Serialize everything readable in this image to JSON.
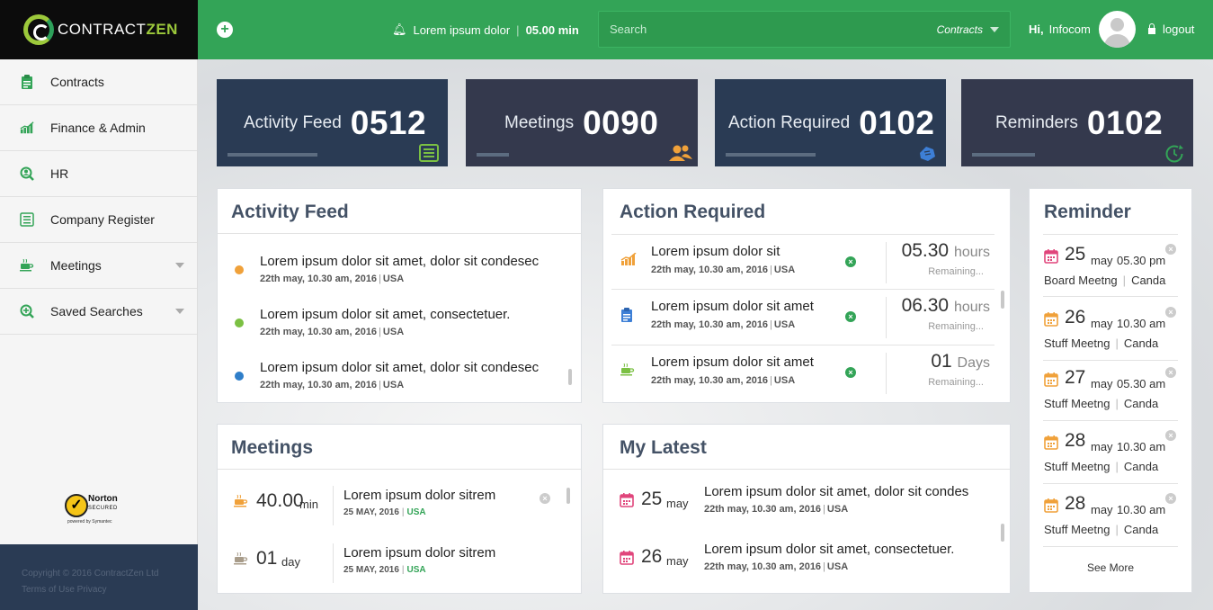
{
  "brand": {
    "name_part1": "CONTRACT",
    "name_part2": "ZEN"
  },
  "topbar": {
    "notification_text": "Lorem ipsum dolor",
    "notification_time": "05.00 min",
    "search_placeholder": "Search",
    "search_scope": "Contracts",
    "greeting": "Hi,",
    "user_name": "Infocom",
    "logout_label": "logout"
  },
  "sidebar": {
    "items": [
      {
        "label": "Contracts",
        "icon": "clipboard-icon"
      },
      {
        "label": "Finance & Admin",
        "icon": "bar-chart-icon"
      },
      {
        "label": "HR",
        "icon": "user-search-icon"
      },
      {
        "label": "Company Register",
        "icon": "list-icon"
      },
      {
        "label": "Meetings",
        "icon": "coffee-cup-icon"
      },
      {
        "label": "Saved Searches",
        "icon": "search-plus-icon"
      }
    ],
    "norton": {
      "brand": "Norton",
      "tag": "SECURED",
      "powered": "powered by Symantec"
    },
    "footer": {
      "copyright": "Copyright © 2016 ContractZen Ltd",
      "links": "Terms of Use Privacy"
    }
  },
  "tiles": [
    {
      "label": "Activity Feed",
      "value": "0512",
      "color": "#2a3b54",
      "icon": "list-icon",
      "icon_color": "#7bc043"
    },
    {
      "label": "Meetings",
      "value": "0090",
      "color": "#34394d",
      "icon": "users-icon",
      "icon_color": "#f0a13a"
    },
    {
      "label": "Action Required",
      "value": "0102",
      "color": "#2a3b54",
      "icon": "hand-icon",
      "icon_color": "#3d7fd6"
    },
    {
      "label": "Reminders",
      "value": "0102",
      "color": "#34394d",
      "icon": "refresh-clock-icon",
      "icon_color": "#33a457"
    }
  ],
  "activity_feed": {
    "title": "Activity Feed",
    "items": [
      {
        "text": "Lorem ipsum dolor sit amet, dolor sit condesec",
        "date": "22th may, 10.30 am, 2016",
        "loc": "USA",
        "dot": "#f0a13a"
      },
      {
        "text": "Lorem ipsum dolor sit amet, consectetuer.",
        "date": "22th may, 10.30 am, 2016",
        "loc": "USA",
        "dot": "#7bc043"
      },
      {
        "text": "Lorem ipsum dolor sit amet, dolor sit condesec",
        "date": "22th may, 10.30 am, 2016",
        "loc": "USA",
        "dot": "#2f7ec9"
      }
    ]
  },
  "action_required": {
    "title": "Action Required",
    "items": [
      {
        "text": "Lorem ipsum dolor sit",
        "date": "22th may, 10.30 am, 2016",
        "loc": "USA",
        "value": "05.30",
        "unit": "hours",
        "remaining": "Remaining...",
        "icon": "bar-chart-icon"
      },
      {
        "text": "Lorem ipsum dolor sit amet",
        "date": "22th may, 10.30 am, 2016",
        "loc": "USA",
        "value": "06.30",
        "unit": "hours",
        "remaining": "Remaining...",
        "icon": "clipboard-icon"
      },
      {
        "text": "Lorem ipsum dolor sit amet",
        "date": "22th may, 10.30 am, 2016",
        "loc": "USA",
        "value": "01",
        "unit": "Days",
        "remaining": "Remaining...",
        "icon": "coffee-cup-icon"
      }
    ]
  },
  "reminder": {
    "title": "Reminder",
    "see_more": "See More",
    "items": [
      {
        "day": "25",
        "month": "may",
        "time": "05.30 pm",
        "event": "Board Meetng",
        "place": "Canda",
        "cal_color": "#e0457b"
      },
      {
        "day": "26",
        "month": "may",
        "time": "10.30 am",
        "event": "Stuff Meetng",
        "place": "Canda",
        "cal_color": "#f0a13a"
      },
      {
        "day": "27",
        "month": "may",
        "time": "05.30 am",
        "event": "Stuff Meetng",
        "place": "Canda",
        "cal_color": "#f0a13a"
      },
      {
        "day": "28",
        "month": "may",
        "time": "10.30 am",
        "event": "Stuff Meetng",
        "place": "Canda",
        "cal_color": "#f0a13a"
      },
      {
        "day": "28",
        "month": "may",
        "time": "10.30 am",
        "event": "Stuff Meetng",
        "place": "Canda",
        "cal_color": "#f0a13a"
      }
    ]
  },
  "meetings": {
    "title": "Meetings",
    "items": [
      {
        "num": "40.00",
        "unit": "min",
        "text": "Lorem ipsum dolor sitrem",
        "date": "25 MAY, 2016",
        "loc": "USA"
      },
      {
        "num": "01",
        "unit": "day",
        "text": "Lorem ipsum dolor sitrem",
        "date": "25 MAY, 2016",
        "loc": "USA"
      }
    ]
  },
  "my_latest": {
    "title": "My Latest",
    "items": [
      {
        "day": "25",
        "month": "may",
        "text": "Lorem ipsum dolor sit amet, dolor sit condes",
        "date": "22th may, 10.30 am, 2016",
        "loc": "USA"
      },
      {
        "day": "26",
        "month": "may",
        "text": "Lorem ipsum dolor sit amet, consectetuer.",
        "date": "22th may, 10.30 am, 2016",
        "loc": "USA"
      }
    ]
  }
}
